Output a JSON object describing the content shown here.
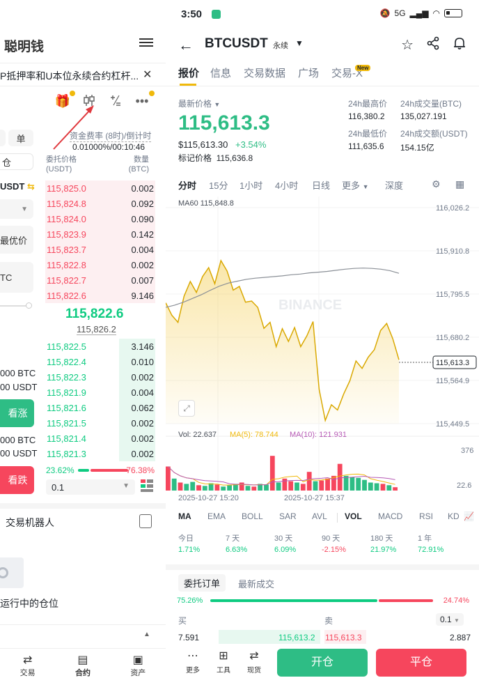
{
  "left": {
    "title": "聪明钱",
    "banner_text": "P抵押率和U本位永续合约杠杆...",
    "funding_label": "资金费率 (8时)/倒计时",
    "funding_value": "0.01000%/00:10:46",
    "side_label_single": "单",
    "side_label_cang": "仓",
    "usdt_label": "USDT",
    "best_price": "最优价",
    "btc_label": "TC",
    "ob_head_price": "委托价格\n(USDT)",
    "ob_head_qty": "数量\n(BTC)",
    "asks": [
      {
        "p": "115,825.0",
        "q": "0.002"
      },
      {
        "p": "115,824.8",
        "q": "0.092"
      },
      {
        "p": "115,824.0",
        "q": "0.090"
      },
      {
        "p": "115,823.9",
        "q": "0.142"
      },
      {
        "p": "115,823.7",
        "q": "0.004"
      },
      {
        "p": "115,822.8",
        "q": "0.002"
      },
      {
        "p": "115,822.7",
        "q": "0.007"
      },
      {
        "p": "115,822.6",
        "q": "9.146"
      }
    ],
    "mid_price": "115,822.6",
    "mark_price": "115,826.2",
    "bids": [
      {
        "p": "115,822.5",
        "q": "3.146"
      },
      {
        "p": "115,822.4",
        "q": "0.010"
      },
      {
        "p": "115,822.3",
        "q": "0.002"
      },
      {
        "p": "115,821.9",
        "q": "0.004"
      },
      {
        "p": "115,821.6",
        "q": "0.062"
      },
      {
        "p": "115,821.5",
        "q": "0.002"
      },
      {
        "p": "115,821.4",
        "q": "0.002"
      },
      {
        "p": "115,821.3",
        "q": "0.002"
      }
    ],
    "buy_ratio": "23.62%",
    "sell_ratio": "76.38%",
    "step": "0.1",
    "long_btc": "000 BTC",
    "long_usdt": "00 USDT",
    "short_btc": "000 BTC",
    "short_usdt": "00 USDT",
    "long_btn": "看涨",
    "short_btn": "看跌",
    "robot": "交易机器人",
    "positions": "运行中的仓位",
    "nav": [
      "交易",
      "合约",
      "资产"
    ]
  },
  "right": {
    "status_time": "3:50",
    "status_net": "5G",
    "symbol": "BTCUSDT",
    "symbol_type": "永续",
    "tabs": [
      "报价",
      "信息",
      "交易数据",
      "广场",
      "交易-X"
    ],
    "new_badge": "New",
    "latest_price_label": "最新价格",
    "latest_price": "115,613.3",
    "price_usd": "$115,613.30",
    "change": "+3.54%",
    "mark_label": "标记价格",
    "mark_value": "115,636.8",
    "stats": {
      "high_label": "24h最高价",
      "high": "116,380.2",
      "low_label": "24h最低价",
      "low": "111,635.6",
      "vol_btc_label": "24h成交量(BTC)",
      "vol_btc": "135,027.191",
      "vol_usdt_label": "24h成交额(USDT)",
      "vol_usdt": "154.15亿"
    },
    "timeframes": [
      "分时",
      "15分",
      "1小时",
      "4小时",
      "日线",
      "更多",
      "深度"
    ],
    "ma60_label": "MA60 115,848.8",
    "vol_label": "Vol: 22.637",
    "ma5_label": "MA(5): 78.744",
    "ma10_label": "MA(10): 121.931",
    "date1": "2025-10-27 15:20",
    "date2": "2025-10-27 15:37",
    "indicators": [
      "MA",
      "EMA",
      "BOLL",
      "SAR",
      "AVL",
      "VOL",
      "MACD",
      "RSI",
      "KD"
    ],
    "perf": [
      {
        "k": "今日",
        "v": "1.71%",
        "c": "#0ecb81"
      },
      {
        "k": "7 天",
        "v": "6.63%",
        "c": "#0ecb81"
      },
      {
        "k": "30 天",
        "v": "6.09%",
        "c": "#0ecb81"
      },
      {
        "k": "90 天",
        "v": "-2.15%",
        "c": "#f6465d"
      },
      {
        "k": "180 天",
        "v": "21.97%",
        "c": "#0ecb81"
      },
      {
        "k": "1 年",
        "v": "72.91%",
        "c": "#0ecb81"
      }
    ],
    "book_tabs": [
      "委托订单",
      "最新成交"
    ],
    "buy_ratio": "75.26%",
    "sell_ratio": "24.74%",
    "buy_label": "买",
    "sell_label": "卖",
    "step": "0.1",
    "book_row": {
      "bq": "7.591",
      "bp": "115,613.2",
      "sp": "115,613.3",
      "sq": "2.887"
    },
    "bottom": [
      "更多",
      "工具",
      "现货"
    ],
    "open_btn": "开仓",
    "close_btn": "平仓"
  },
  "chart_data": {
    "type": "area",
    "y_ticks": [
      "116,026.2",
      "115,910.8",
      "115,795.5",
      "115,680.2",
      "115,564.9",
      "115,449.5"
    ],
    "ylim": [
      115449.5,
      116026.2
    ],
    "current_price_tag": "115,613.3",
    "watermark": "BINANCE",
    "price_series": [
      115772,
      115739,
      115720,
      115790,
      115829,
      115800,
      115842,
      115866,
      115823,
      115885,
      115857,
      115806,
      115816,
      115774,
      115777,
      115760,
      115704,
      115720,
      115655,
      115703,
      115669,
      115706,
      115655,
      115684,
      115722,
      115541,
      115458,
      115500,
      115486,
      115529,
      115564,
      115617,
      115597,
      115627,
      115647,
      115698,
      115717,
      115676,
      115620
    ],
    "ma60_series": [
      115760,
      115766,
      115774,
      115784,
      115794,
      115806,
      115817,
      115825,
      115830,
      115835,
      115838,
      115840,
      115842,
      115844,
      115847,
      115849,
      115852,
      115854,
      115856,
      115859,
      115862,
      115864,
      115865,
      115864,
      115862,
      115858,
      115851
    ],
    "vol_axis": [
      "376",
      "22.6"
    ],
    "volumes": [
      {
        "v": 180,
        "c": "r"
      },
      {
        "v": 90,
        "c": "g"
      },
      {
        "v": 60,
        "c": "r"
      },
      {
        "v": 50,
        "c": "g"
      },
      {
        "v": 65,
        "c": "g"
      },
      {
        "v": 40,
        "c": "r"
      },
      {
        "v": 35,
        "c": "g"
      },
      {
        "v": 55,
        "c": "g"
      },
      {
        "v": 45,
        "c": "r"
      },
      {
        "v": 30,
        "c": "g"
      },
      {
        "v": 40,
        "c": "g"
      },
      {
        "v": 50,
        "c": "g"
      },
      {
        "v": 60,
        "c": "r"
      },
      {
        "v": 35,
        "c": "g"
      },
      {
        "v": 30,
        "c": "r"
      },
      {
        "v": 50,
        "c": "g"
      },
      {
        "v": 45,
        "c": "g"
      },
      {
        "v": 260,
        "c": "r"
      },
      {
        "v": 60,
        "c": "g"
      },
      {
        "v": 90,
        "c": "r"
      },
      {
        "v": 70,
        "c": "r"
      },
      {
        "v": 60,
        "c": "g"
      },
      {
        "v": 50,
        "c": "r"
      },
      {
        "v": 140,
        "c": "r"
      },
      {
        "v": 70,
        "c": "g"
      },
      {
        "v": 75,
        "c": "r"
      },
      {
        "v": 90,
        "c": "r"
      },
      {
        "v": 110,
        "c": "r"
      },
      {
        "v": 200,
        "c": "r"
      },
      {
        "v": 110,
        "c": "g"
      },
      {
        "v": 100,
        "c": "g"
      },
      {
        "v": 95,
        "c": "g"
      },
      {
        "v": 80,
        "c": "g"
      },
      {
        "v": 60,
        "c": "g"
      },
      {
        "v": 55,
        "c": "g"
      },
      {
        "v": 50,
        "c": "r"
      },
      {
        "v": 40,
        "c": "g"
      },
      {
        "v": 25,
        "c": "r"
      }
    ]
  }
}
